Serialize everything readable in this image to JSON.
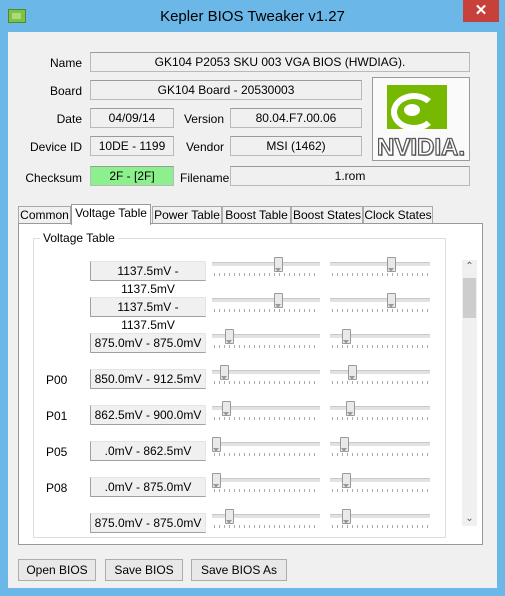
{
  "window": {
    "title": "Kepler BIOS Tweaker v1.27",
    "close_glyph": "✕"
  },
  "info": {
    "name_label": "Name",
    "name_value": "GK104 P2053 SKU 003 VGA BIOS (HWDIAG).",
    "board_label": "Board",
    "board_value": "GK104 Board - 20530003",
    "date_label": "Date",
    "date_value": "04/09/14",
    "version_label": "Version",
    "version_value": "80.04.F7.00.06",
    "device_label": "Device ID",
    "device_value": "10DE - 1199",
    "vendor_label": "Vendor",
    "vendor_value": "MSI (1462)",
    "checksum_label": "Checksum",
    "checksum_value": "2F - [2F]",
    "checksum_color": "#8cf08c",
    "filename_label": "Filename",
    "filename_value": "1.rom"
  },
  "logo": {
    "wordmark": "NVIDIA.",
    "brand_color": "#76b900"
  },
  "tabs": [
    {
      "label": "Common"
    },
    {
      "label": "Voltage Table"
    },
    {
      "label": "Power Table"
    },
    {
      "label": "Boost Table"
    },
    {
      "label": "Boost States"
    },
    {
      "label": "Clock States"
    }
  ],
  "active_tab": "Voltage Table",
  "voltage_table": {
    "group_title": "Voltage Table",
    "rows": [
      {
        "label": "",
        "range": "1137.5mV - 1137.5mV",
        "min_level": 0.63,
        "max_level": 0.63
      },
      {
        "label": "",
        "range": "1137.5mV - 1137.5mV",
        "min_level": 0.63,
        "max_level": 0.63
      },
      {
        "label": "",
        "range": "875.0mV - 875.0mV",
        "min_level": 0.13,
        "max_level": 0.13
      },
      {
        "label": "P00",
        "range": "850.0mV - 912.5mV",
        "min_level": 0.08,
        "max_level": 0.2
      },
      {
        "label": "P01",
        "range": "862.5mV - 900.0mV",
        "min_level": 0.1,
        "max_level": 0.18
      },
      {
        "label": "P05",
        "range": ".0mV - 862.5mV",
        "min_level": 0.0,
        "max_level": 0.11
      },
      {
        "label": "P08",
        "range": ".0mV - 875.0mV",
        "min_level": 0.0,
        "max_level": 0.13
      },
      {
        "label": "",
        "range": "875.0mV - 875.0mV",
        "min_level": 0.13,
        "max_level": 0.13
      }
    ]
  },
  "scrollbar": {
    "up_glyph": "⌃",
    "down_glyph": "⌄"
  },
  "buttons": {
    "open": "Open BIOS",
    "save": "Save BIOS",
    "save_as": "Save BIOS As"
  }
}
